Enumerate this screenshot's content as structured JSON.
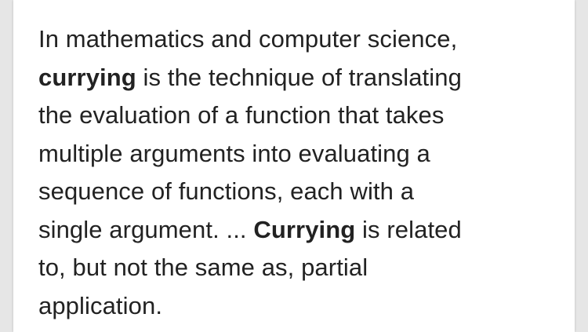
{
  "snippet": {
    "lines": [
      {
        "parts": [
          {
            "text": "In mathematics and computer science,",
            "bold": false
          }
        ]
      },
      {
        "parts": [
          {
            "text": "currying",
            "bold": true
          },
          {
            "text": " is the technique of translating",
            "bold": false
          }
        ]
      },
      {
        "parts": [
          {
            "text": "the evaluation of a function that takes",
            "bold": false
          }
        ]
      },
      {
        "parts": [
          {
            "text": "multiple arguments into evaluating a",
            "bold": false
          }
        ]
      },
      {
        "parts": [
          {
            "text": "sequence of functions, each with a",
            "bold": false
          }
        ]
      },
      {
        "parts": [
          {
            "text": "single argument. ... ",
            "bold": false
          },
          {
            "text": "Currying",
            "bold": true
          },
          {
            "text": " is related",
            "bold": false
          }
        ]
      },
      {
        "parts": [
          {
            "text": "to, but not the same as, partial",
            "bold": false
          }
        ]
      },
      {
        "parts": [
          {
            "text": "application.",
            "bold": false
          }
        ]
      }
    ]
  },
  "colors": {
    "text": "#222222",
    "card_background": "#ffffff",
    "page_background": "#e6e6e6"
  }
}
